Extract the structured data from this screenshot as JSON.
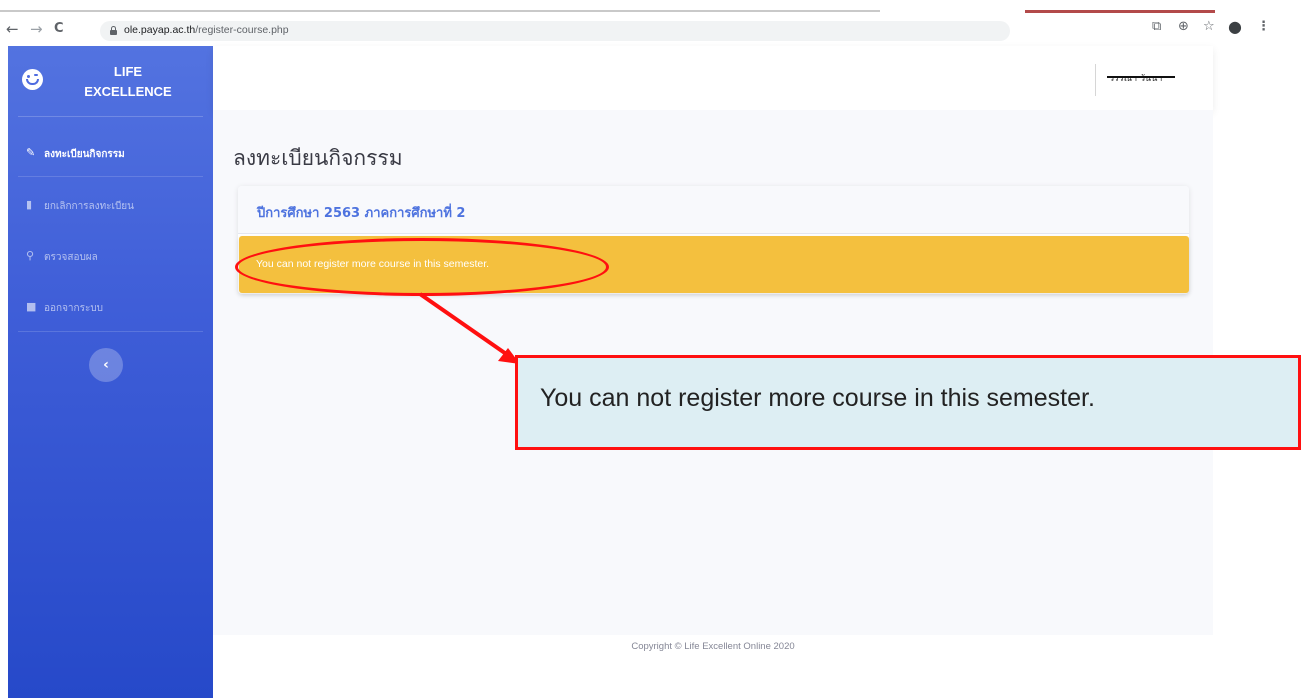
{
  "browser": {
    "url_host": "ole.payap.ac.th",
    "url_path": "/register-course.php",
    "back_icon": "←",
    "forward_icon": "→",
    "reload_icon": "C",
    "right_icons": [
      "translate-icon",
      "zoom-icon",
      "star-icon",
      "profile-icon",
      "menu-icon"
    ]
  },
  "sidebar": {
    "brand_line1": "LIFE",
    "brand_line2": "EXCELLENCE",
    "items": [
      {
        "label": "ลงทะเบียนกิจกรรม",
        "icon": "pencil-icon",
        "active": true
      },
      {
        "label": "ยกเลิกการลงทะเบียน",
        "icon": "trash-icon",
        "active": false
      },
      {
        "label": "ตรวจสอบผล",
        "icon": "search-icon",
        "active": false
      },
      {
        "label": "ออกจากระบบ",
        "icon": "lock-icon",
        "active": false
      }
    ],
    "toggle_symbol": "‹"
  },
  "topbar": {
    "user_name": "วรรณา วันนา"
  },
  "main": {
    "page_title": "ลงทะเบียนกิจกรรม",
    "card_title": "ปีการศึกษา 2563 ภาคการศึกษาที่ 2",
    "alert_text": "You can not register more course in this semester."
  },
  "footer": {
    "copyright": "Copyright © Life Excellent Online 2020"
  },
  "annotation": {
    "callout_text": "You can not register more course in this semester.",
    "color": "#ff1010"
  },
  "colors": {
    "sidebar_top": "#5373e0",
    "sidebar_bottom": "#2649c9",
    "alert": "#f4c03e",
    "card_title": "#4e73df"
  }
}
